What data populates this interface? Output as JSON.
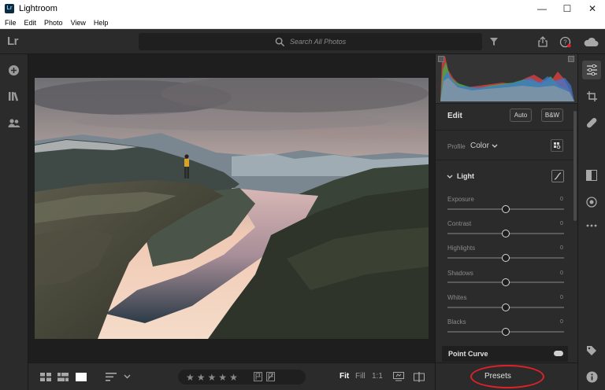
{
  "window": {
    "title": "Lightroom",
    "app_badge": "Lr",
    "controls": {
      "minimize": "—",
      "maximize": "☐",
      "close": "✕"
    }
  },
  "menu": [
    "File",
    "Edit",
    "Photo",
    "View",
    "Help"
  ],
  "toolbar": {
    "logo": "Lr",
    "search_placeholder": "Search All Photos",
    "icons": [
      "filter-icon",
      "share-icon",
      "help-icon",
      "cloud-icon"
    ]
  },
  "left_rail": {
    "icons": [
      "add-photos-icon",
      "library-icon",
      "people-icon"
    ]
  },
  "bottom_bar": {
    "view_icons": [
      "square-grid-icon",
      "photo-grid-icon",
      "detail-view-icon",
      "sort-icon"
    ],
    "rating": {
      "stars": [
        "★",
        "★",
        "★",
        "★",
        "★"
      ],
      "value": 0
    },
    "zoom": {
      "fit": "Fit",
      "fill": "Fill",
      "one_to_one": "1:1"
    }
  },
  "edit_panel": {
    "title": "Edit",
    "auto_label": "Auto",
    "bw_label": "B&W",
    "profile_label": "Profile",
    "profile_value": "Color",
    "light_title": "Light",
    "sliders": [
      {
        "label": "Exposure",
        "value": "0",
        "position": 0.5
      },
      {
        "label": "Contrast",
        "value": "0",
        "position": 0.5
      },
      {
        "label": "Highlights",
        "value": "0",
        "position": 0.5
      },
      {
        "label": "Shadows",
        "value": "0",
        "position": 0.5
      },
      {
        "label": "Whites",
        "value": "0",
        "position": 0.5
      },
      {
        "label": "Blacks",
        "value": "0",
        "position": 0.5
      }
    ],
    "point_curve_title": "Point Curve",
    "presets_label": "Presets"
  },
  "right_rail": {
    "icons": [
      "edit-sliders-icon",
      "crop-icon",
      "healing-icon",
      "masking-icon",
      "red-eye-icon",
      "more-icon",
      "tag-icon",
      "info-icon"
    ]
  },
  "colors": {
    "accent_highlight": "#e0212a",
    "panel": "#2b2b2b",
    "canvas": "#1e1e1e"
  }
}
